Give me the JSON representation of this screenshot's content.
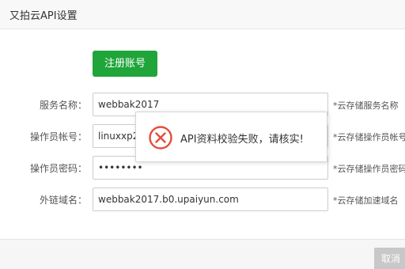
{
  "dialog": {
    "title": "又拍云API设置"
  },
  "register_button": {
    "label": "注册账号",
    "color": "#20a53a"
  },
  "form": {
    "fields": [
      {
        "label": "服务名称：",
        "value": "webbak2017",
        "hint": "*云存储服务名称"
      },
      {
        "label": "操作员帐号：",
        "value": "linuxxp2017",
        "hint": "*云存储操作员帐号"
      },
      {
        "label": "操作员密码：",
        "value": "........",
        "hint": "*云存储操作员密码"
      },
      {
        "label": "外链域名：",
        "value": "webbak2017.b0.upaiyun.com",
        "hint": "*云存储加速域名"
      }
    ]
  },
  "footer": {
    "cancel_label": "取消"
  },
  "toast": {
    "message": "API资料校验失败，请核实!",
    "icon": "error-circle-icon",
    "icon_color": "#e64c3c"
  }
}
